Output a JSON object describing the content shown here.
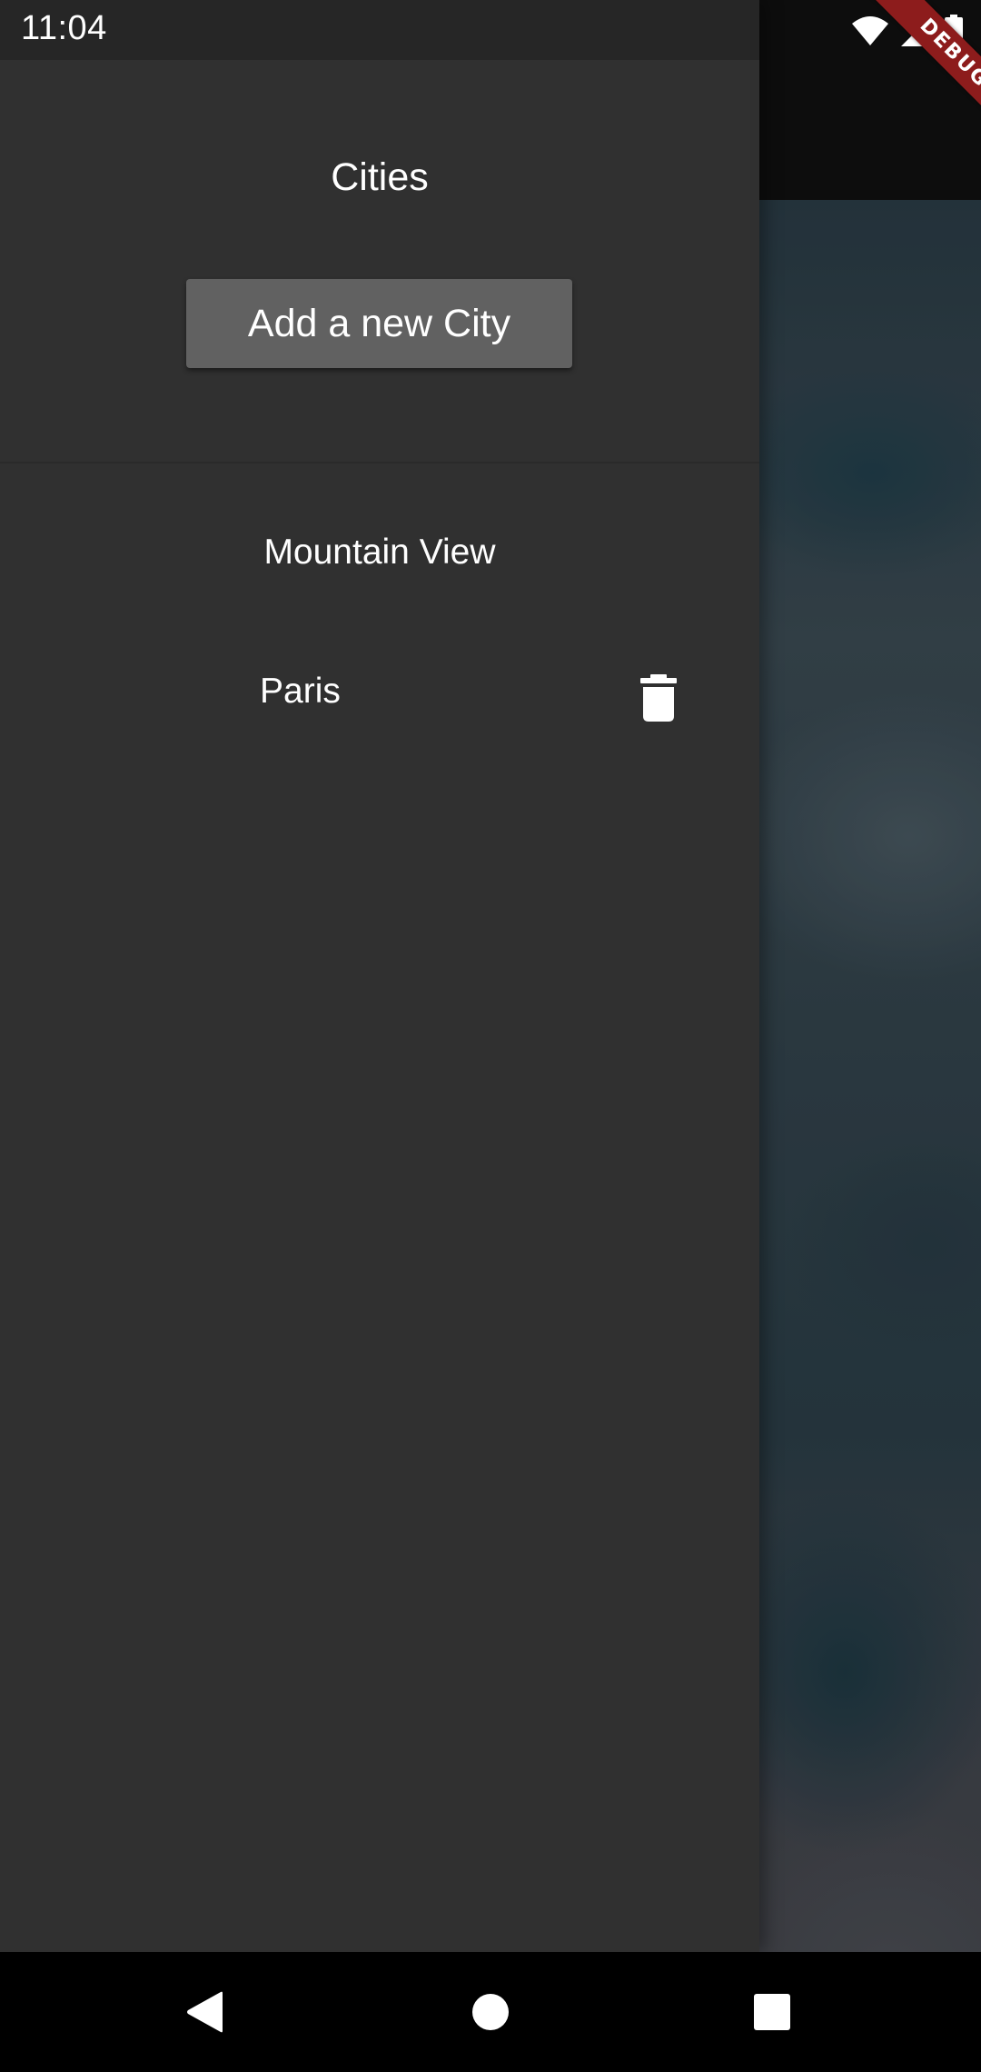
{
  "status_bar": {
    "time": "11:04",
    "icons": [
      "wifi-icon",
      "cellular-signal-icon",
      "battery-icon"
    ]
  },
  "debug_banner": {
    "label": "DEBUG",
    "color": "#8d1c1c"
  },
  "drawer": {
    "title": "Cities",
    "add_button_label": "Add a new City",
    "cities": [
      {
        "name": "Mountain View",
        "deletable": false
      },
      {
        "name": "Paris",
        "deletable": true,
        "delete_icon": "trash-icon"
      }
    ]
  },
  "nav_bar": {
    "buttons": [
      "back-icon",
      "home-icon",
      "recents-icon"
    ]
  },
  "colors": {
    "drawer_background": "#303030",
    "button_background": "#616161",
    "text": "#ffffff",
    "app_bar": "#101010"
  }
}
